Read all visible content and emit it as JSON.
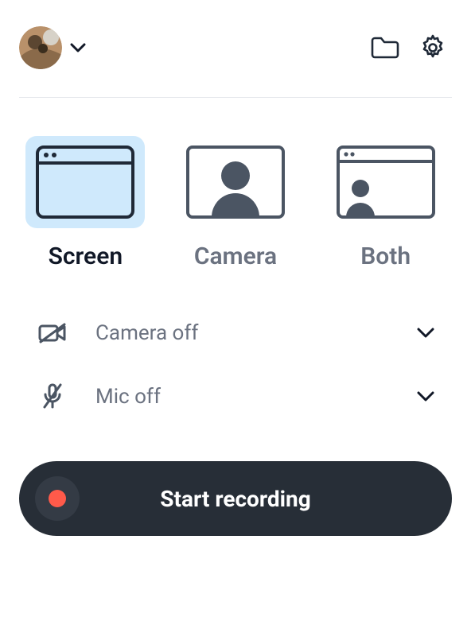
{
  "modes": {
    "screen": "Screen",
    "camera": "Camera",
    "both": "Both"
  },
  "camera_option_label": "Camera off",
  "mic_option_label": "Mic off",
  "record_button": "Start recording"
}
